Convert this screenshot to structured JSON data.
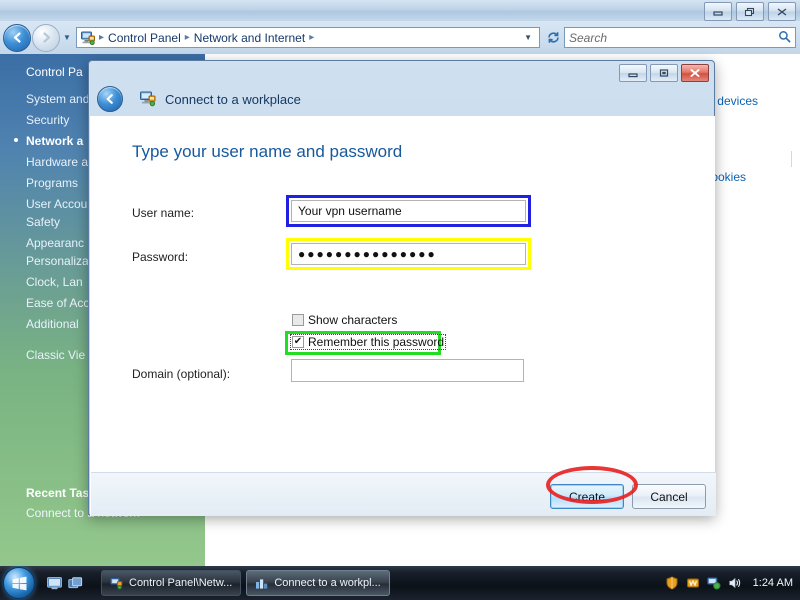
{
  "explorer": {
    "window_buttons": [
      "minimize",
      "restore",
      "close"
    ],
    "nav": {
      "back_title": "Back",
      "forward_title": "Forward",
      "history_title": "Recent pages"
    },
    "address": {
      "icon": "network-computer-icon",
      "crumbs": [
        "Control Panel",
        "Network and Internet"
      ],
      "separator": "▸",
      "dropdown": "▼"
    },
    "refresh_label": "↻",
    "search": {
      "placeholder": "Search",
      "icon": "search-icon"
    },
    "sidebar": {
      "header": "Control Pa",
      "items": [
        {
          "label": "System and",
          "active": false
        },
        {
          "label": "Security",
          "active": false
        },
        {
          "label": "Network a",
          "active": true
        },
        {
          "label": "Hardware a",
          "active": false
        },
        {
          "label": "Programs",
          "active": false
        },
        {
          "label": "User Accou",
          "active": false
        },
        {
          "label": "Safety",
          "active": false
        },
        {
          "label": "Appearanc",
          "active": false
        },
        {
          "label": "Personaliza",
          "active": false
        },
        {
          "label": "Clock, Lan",
          "active": false
        },
        {
          "label": "Ease of Acc",
          "active": false
        },
        {
          "label": "Additional",
          "active": false
        }
      ],
      "classic_view": "Classic Vie",
      "recent_tasks_title": "Recent Tasks",
      "recent_task_link": "Connect to a network"
    },
    "content_links": [
      "and devices",
      "l cookies"
    ]
  },
  "dialog": {
    "title": "Connect to a workplace",
    "title_icon": "network-connection-icon",
    "back_button": "Back",
    "window_buttons": [
      "minimize",
      "restore",
      "close"
    ],
    "heading": "Type your user name and password",
    "fields": {
      "username": {
        "label": "User name:",
        "value": "Your vpn username",
        "highlight": "#2020e0"
      },
      "password": {
        "label": "Password:",
        "value": "●●●●●●●●●●●●●●●",
        "highlight": "#ffff00"
      },
      "domain": {
        "label": "Domain (optional):",
        "value": ""
      }
    },
    "checkboxes": {
      "show_characters": {
        "label": "Show characters",
        "checked": false
      },
      "remember_password": {
        "label": "Remember this password",
        "checked": true,
        "check_glyph": "✔",
        "highlight": "#22dd22"
      }
    },
    "buttons": {
      "create": "Create",
      "cancel": "Cancel"
    },
    "annotation": {
      "shape": "ellipse",
      "color": "#e81f1f",
      "target": "Create"
    }
  },
  "taskbar": {
    "start_label": "Start",
    "quicklaunch": [
      "show-desktop-icon",
      "switch-windows-icon"
    ],
    "tasks": [
      {
        "label": "Control Panel\\Netw...",
        "icon": "network-computer-icon",
        "active": false
      },
      {
        "label": "Connect to a workpl...",
        "icon": "connection-icon",
        "active": true
      }
    ],
    "tray_icons": [
      "shield-icon",
      "flag-icon",
      "network-icon",
      "volume-icon"
    ],
    "clock": "1:24 AM"
  }
}
